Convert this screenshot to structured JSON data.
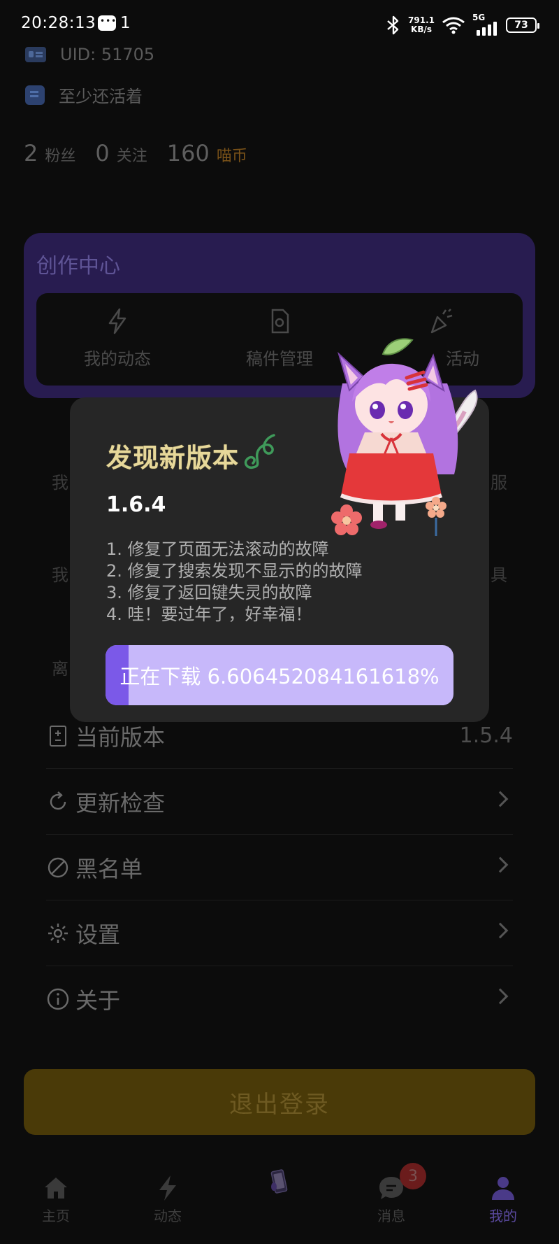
{
  "status_bar": {
    "time": "20:28:13",
    "notification_count": "1",
    "net_speed_value": "791.1",
    "net_speed_unit": "KB/s",
    "network_type": "5G",
    "battery": "73"
  },
  "profile": {
    "uid": "UID: 51705",
    "signature": "至少还活着",
    "followers_count": "2",
    "followers_label": "粉丝",
    "following_count": "0",
    "following_label": "关注",
    "coins_count": "160",
    "coins_label": "喵币"
  },
  "creation_center": {
    "title": "创作中心",
    "items": [
      {
        "label": "我的动态",
        "icon": "lightning-icon"
      },
      {
        "label": "稿件管理",
        "icon": "file-settings-icon"
      },
      {
        "label": "活动",
        "icon": "party-popper-icon"
      }
    ]
  },
  "ghost_rows": {
    "left_1": "我",
    "right_1": "服",
    "left_2": "我",
    "right_2": "具",
    "left_3": "离"
  },
  "menu": {
    "items": [
      {
        "label": "当前版本",
        "value": "1.5.4",
        "icon": "version-icon"
      },
      {
        "label": "更新检查",
        "icon": "refresh-icon"
      },
      {
        "label": "黑名单",
        "icon": "ban-icon"
      },
      {
        "label": "设置",
        "icon": "gear-icon"
      },
      {
        "label": "关于",
        "icon": "info-icon"
      }
    ]
  },
  "logout_label": "退出登录",
  "bottom_nav": {
    "items": [
      {
        "label": "主页",
        "icon": "home-icon"
      },
      {
        "label": "动态",
        "icon": "lightning-icon"
      },
      {
        "label": "",
        "icon": "phone-device-icon"
      },
      {
        "label": "消息",
        "icon": "chat-icon",
        "badge": "3"
      },
      {
        "label": "我的",
        "icon": "user-icon",
        "active": true
      }
    ]
  },
  "dialog": {
    "title": "发现新版本",
    "version": "1.6.4",
    "notes": [
      "1. 修复了页面无法滚动的故障",
      "2. 修复了搜索发现不显示的的故障",
      "3. 修复了返回键失灵的故障",
      "4. 哇！要过年了，好幸福！"
    ],
    "progress_text": "正在下载 6.606452084161618%",
    "progress_percent": 6.606452084161618
  },
  "colors": {
    "accent": "#7b59e8",
    "progress_track": "#c7b8fa",
    "title_gold": "#e7d89a",
    "creation_bg": "#281c50",
    "logout_bg": "#4a3a08"
  }
}
